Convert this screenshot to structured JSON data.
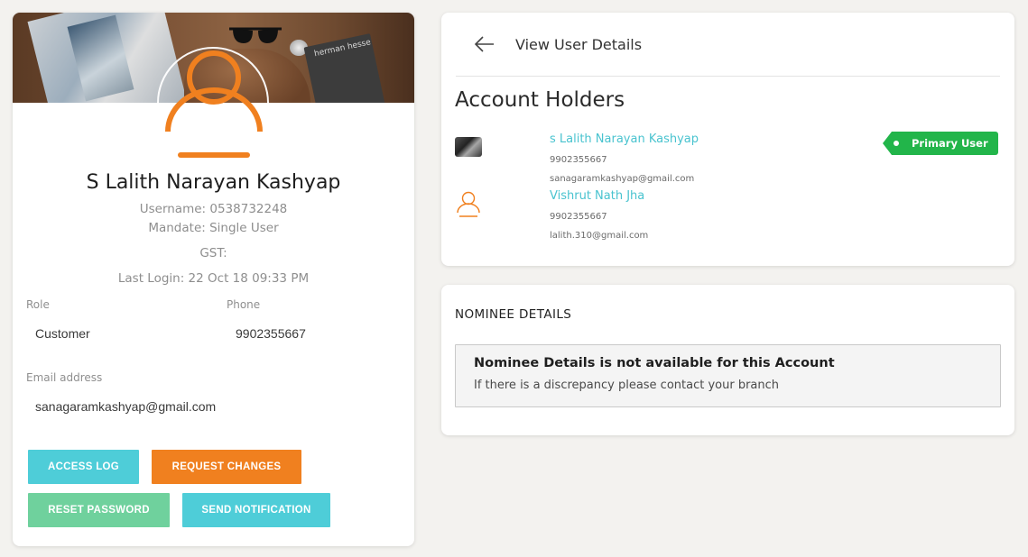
{
  "profile": {
    "name": "S Lalith Narayan Kashyap",
    "username": "Username: 0538732248",
    "mandate": "Mandate: Single User",
    "gst": "GST:",
    "last_login": "Last Login: 22 Oct 18 09:33 PM",
    "cover_book_text": "herman hesse",
    "role_label": "Role",
    "role_value": "Customer",
    "phone_label": "Phone",
    "phone_value": "9902355667",
    "email_label": "Email address",
    "email_value": "sanagaramkashyap@gmail.com"
  },
  "actions": {
    "access_log": "ACCESS LOG",
    "request_changes": "REQUEST CHANGES",
    "reset_password": "RESET PASSWORD",
    "send_notification": "SEND NOTIFICATION"
  },
  "details": {
    "title": "View User Details",
    "section_title": "Account Holders",
    "holders": [
      {
        "name": "s Lalith Narayan Kashyap",
        "phone": "9902355667",
        "email": "sanagaramkashyap@gmail.com",
        "badge": "Primary User",
        "icon": "photo-thumbnail"
      },
      {
        "name": "Vishrut Nath Jha",
        "phone": "9902355667",
        "email": "lalith.310@gmail.com",
        "icon": "user-icon"
      }
    ]
  },
  "nominee": {
    "title": "NOMINEE DETAILS",
    "message_title": "Nominee Details is not available for this Account",
    "message_sub": "If there is a discrepancy please contact your branch"
  },
  "colors": {
    "accent_teal": "#4ecdd8",
    "accent_orange": "#f0801f",
    "accent_green": "#6fd19d",
    "primary_badge": "#22b54a",
    "link": "#49c3cf"
  }
}
